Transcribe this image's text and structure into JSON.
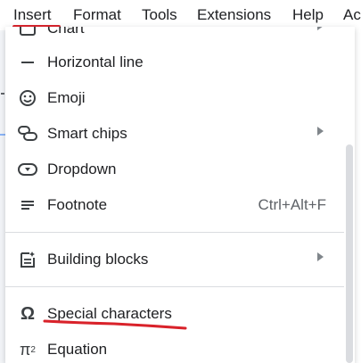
{
  "menubar": {
    "items": [
      "Insert",
      "Format",
      "Tools",
      "Extensions",
      "Help",
      "Ac"
    ]
  },
  "dropdown": {
    "partial_top": {
      "label": "Chart"
    },
    "items": [
      {
        "label": "Horizontal line",
        "icon": "horizontal-line-icon"
      },
      {
        "label": "Emoji",
        "icon": "emoji-icon"
      },
      {
        "label": "Smart chips",
        "icon": "smart-chips-icon",
        "submenu": true
      },
      {
        "label": "Dropdown",
        "icon": "dropdown-icon"
      },
      {
        "label": "Footnote",
        "icon": "footnote-icon",
        "shortcut": "Ctrl+Alt+F"
      },
      {
        "label": "Building blocks",
        "icon": "building-blocks-icon",
        "submenu": true
      },
      {
        "label": "Special characters",
        "icon": "omega-icon"
      },
      {
        "label": "Equation",
        "icon": "pi-squared-icon"
      }
    ]
  },
  "colors": {
    "annotation_red": "#d9222a",
    "text": "#202124",
    "icon": "#3c4043",
    "separator": "#dadce0"
  }
}
